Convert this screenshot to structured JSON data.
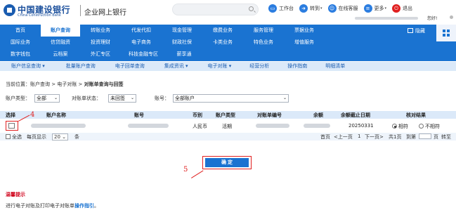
{
  "header": {
    "bank_name": "中国建设银行",
    "bank_name_en": "China Construction Bank",
    "site_title": "企业网上银行",
    "tools": [
      {
        "label": "工作台",
        "icon": "workbench-icon",
        "caret": ""
      },
      {
        "label": "转到",
        "icon": "goto-icon",
        "caret": "▾"
      },
      {
        "label": "在线客服",
        "icon": "customer-service-icon",
        "caret": ""
      },
      {
        "label": "更多",
        "icon": "more-icon",
        "caret": "▾"
      },
      {
        "label": "退出",
        "icon": "logout-icon",
        "caret": ""
      }
    ],
    "greeting": "您好!"
  },
  "nav": {
    "row1": [
      "首页",
      "账户查询",
      "转账业务",
      "代发代扣",
      "现金管理",
      "缴费业务",
      "服务管理",
      "票据业务"
    ],
    "row2": [
      "国际业务",
      "信贷融资",
      "投资理财",
      "电子商务",
      "财政社保",
      "卡类业务",
      "特色业务",
      "增值服务"
    ],
    "row3": [
      "数字钱包",
      "云档案",
      "外汇专区",
      "科技金融专区",
      "薪享通"
    ],
    "hide_label": "隐藏"
  },
  "subnav": [
    "账户信息查询",
    "批量账户查询",
    "电子回单查询",
    "集成资讯",
    "电子对账",
    "经营分析",
    "操作指南",
    "明细清单"
  ],
  "breadcrumb": {
    "prefix": "当前位置：账户查询 > 电子对账 > ",
    "current": "对账单查询与回签"
  },
  "filters": {
    "account_type_label": "账户类型：",
    "account_type_value": "全部",
    "status_label": "对账单状态：",
    "status_value": "未回签",
    "account_label": "账号：",
    "account_value": "全部账户"
  },
  "table": {
    "headers": [
      "选择",
      "账户名称",
      "账号",
      "币别",
      "账户类型",
      "对账单编号",
      "余额",
      "余额截止日期",
      "核对结果"
    ],
    "row": {
      "currency": "人民币",
      "account_type": "活期",
      "date": "20250331",
      "result_match": "相符",
      "result_mismatch": "不相符"
    }
  },
  "footer": {
    "select_all": "全选",
    "per_page_label": "每页显示",
    "per_page_value": "20",
    "per_page_unit": "条",
    "first": "首页",
    "prev": "<上一页",
    "page_num": "1",
    "next": "下一页>",
    "total": "共1页",
    "goto_label": "到第",
    "page_unit": "页",
    "go": "转至"
  },
  "confirm_label": "确 定",
  "annotations": {
    "checkbox": "4",
    "button": "5"
  },
  "tip": {
    "title": "温馨提示",
    "text": "进行电子对账及打印电子对账单",
    "link": "操作指引",
    "suffix": "。"
  }
}
